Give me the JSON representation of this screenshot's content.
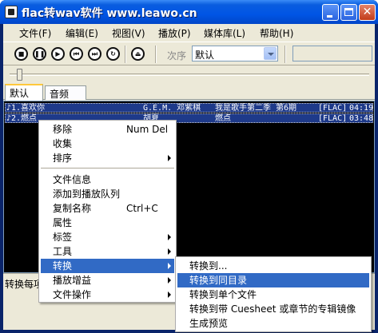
{
  "window": {
    "title": "flac转wav软件 www.leawo.cn"
  },
  "menubar": [
    "文件(F)",
    "编辑(E)",
    "视图(V)",
    "播放(P)",
    "媒体库(L)",
    "帮助(H)"
  ],
  "toolbar": {
    "buttons": [
      "stop-icon",
      "pause-icon",
      "play-icon",
      "previous-icon",
      "next-icon",
      "repeat-icon",
      "eject-icon"
    ],
    "order_label": "次序",
    "order_value": "默认"
  },
  "tabs": [
    "默认",
    "音频 CD"
  ],
  "playlist": [
    {
      "title": "♪1.喜欢你",
      "artist": "G.E.M. 邓紫棋",
      "album": "我是歌手第二季 第6期",
      "format": "[FLAC]",
      "duration": "04:19"
    },
    {
      "title": "♪2.燃点",
      "artist": "胡夏",
      "album": "燃点",
      "format": "[FLAC]",
      "duration": "03:48"
    }
  ],
  "status": {
    "text": "转换每项"
  },
  "context_menu": {
    "items": [
      {
        "label": "移除",
        "shortcut": "Num Del"
      },
      {
        "label": "收集"
      },
      {
        "label": "排序",
        "submenu": true
      },
      {
        "label": "文件信息"
      },
      {
        "label": "添加到播放队列"
      },
      {
        "label": "复制名称",
        "shortcut": "Ctrl+C"
      },
      {
        "label": "属性"
      },
      {
        "label": "标签",
        "submenu": true
      },
      {
        "label": "工具",
        "submenu": true
      },
      {
        "label": "转换",
        "submenu": true,
        "highlighted": true
      },
      {
        "label": "播放增益",
        "submenu": true
      },
      {
        "label": "文件操作",
        "submenu": true
      }
    ]
  },
  "submenu": {
    "items": [
      {
        "label": "转换到..."
      },
      {
        "label": "转换到同目录",
        "highlighted": true
      },
      {
        "label": "转换到单个文件"
      },
      {
        "label": "转换到带 Cuesheet 或章节的专辑镜像"
      },
      {
        "label": "生成预览"
      }
    ]
  },
  "colors": {
    "titlebar": "#0055e5",
    "highlight": "#316ac5",
    "selected_row": "#1e3a8a",
    "face": "#ece9d8"
  }
}
